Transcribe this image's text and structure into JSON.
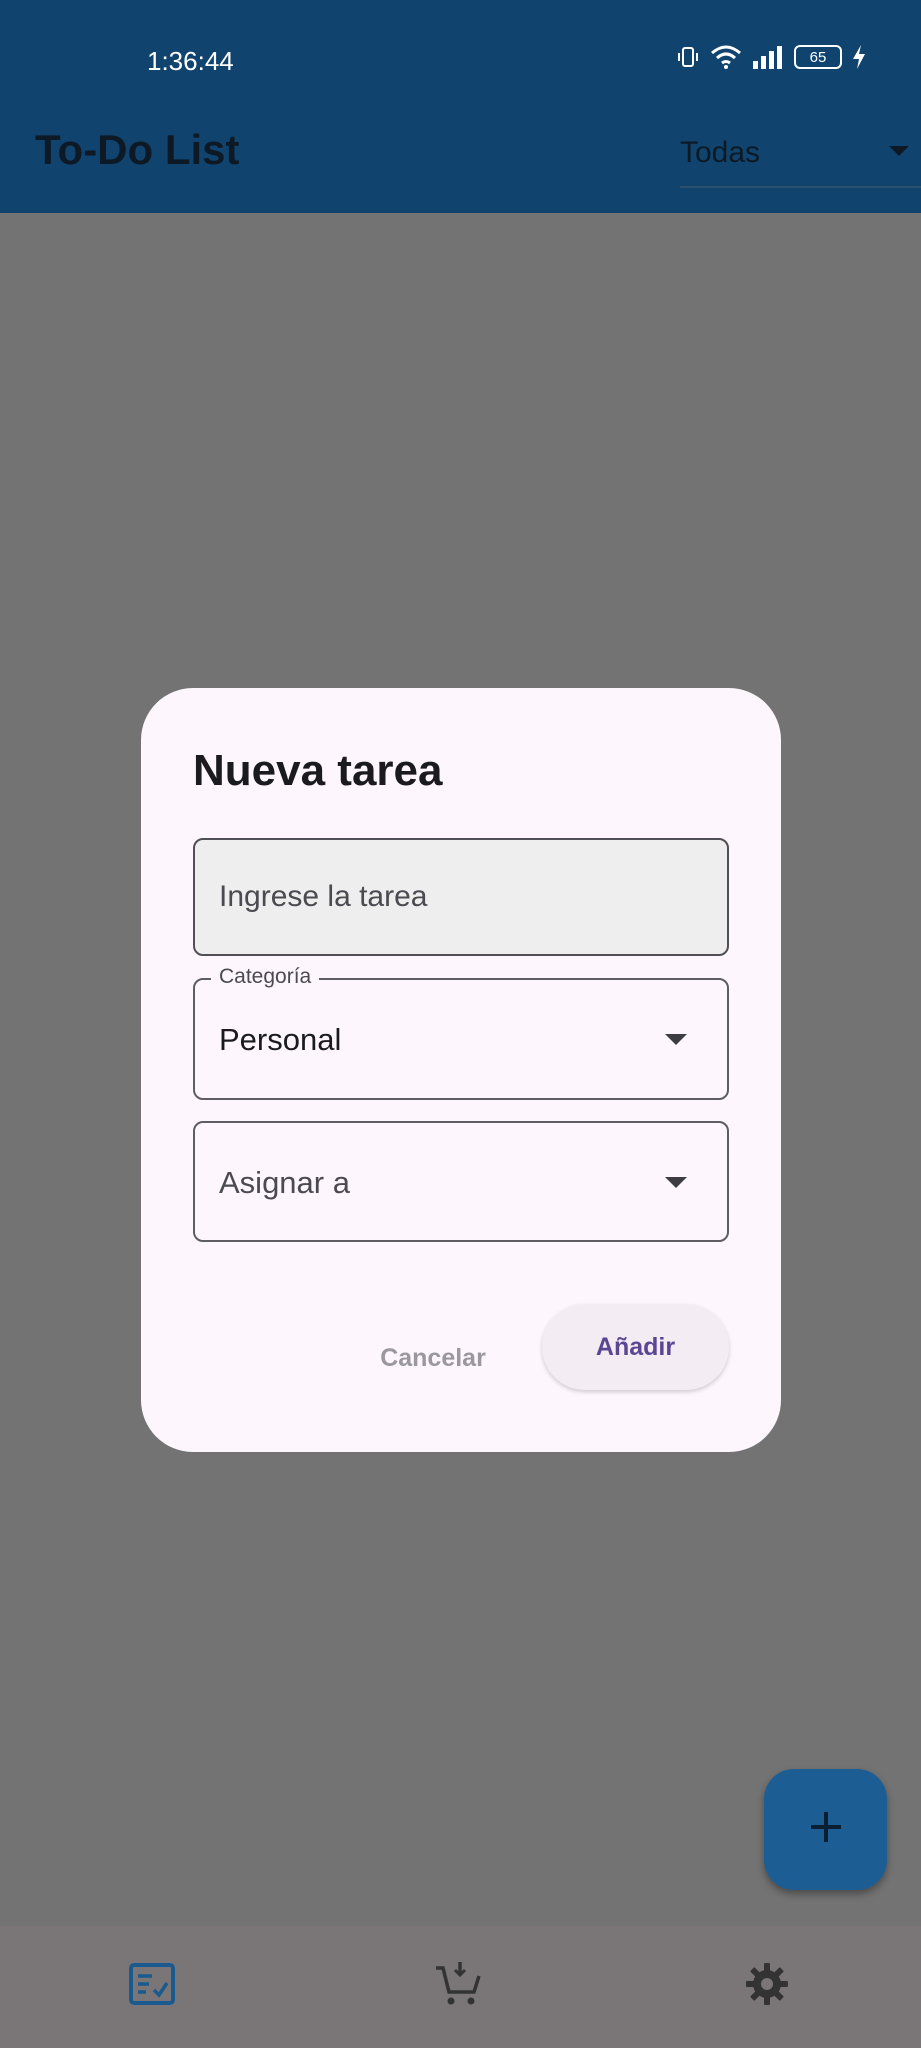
{
  "status_bar": {
    "time": "1:36:44",
    "battery_level": "65",
    "icons": [
      "vibrate-icon",
      "wifi-icon",
      "signal-icon",
      "battery-icon",
      "charging-icon"
    ]
  },
  "app_bar": {
    "title": "To-Do List",
    "filter_value": "Todas",
    "background_color": "#10446f"
  },
  "dialog": {
    "title": "Nueva tarea",
    "task_input": {
      "value": "",
      "placeholder": "Ingrese la tarea"
    },
    "category": {
      "label": "Categoría",
      "value": "Personal"
    },
    "assign": {
      "placeholder": "Asignar a"
    },
    "cancel_label": "Cancelar",
    "add_label": "Añadir"
  },
  "fab": {
    "icon": "plus-icon",
    "color": "#1c5e94"
  },
  "bottom_nav": {
    "items": [
      {
        "icon": "task-list-icon",
        "active": true
      },
      {
        "icon": "shopping-cart-icon",
        "active": false
      },
      {
        "icon": "gear-icon",
        "active": false
      }
    ]
  }
}
